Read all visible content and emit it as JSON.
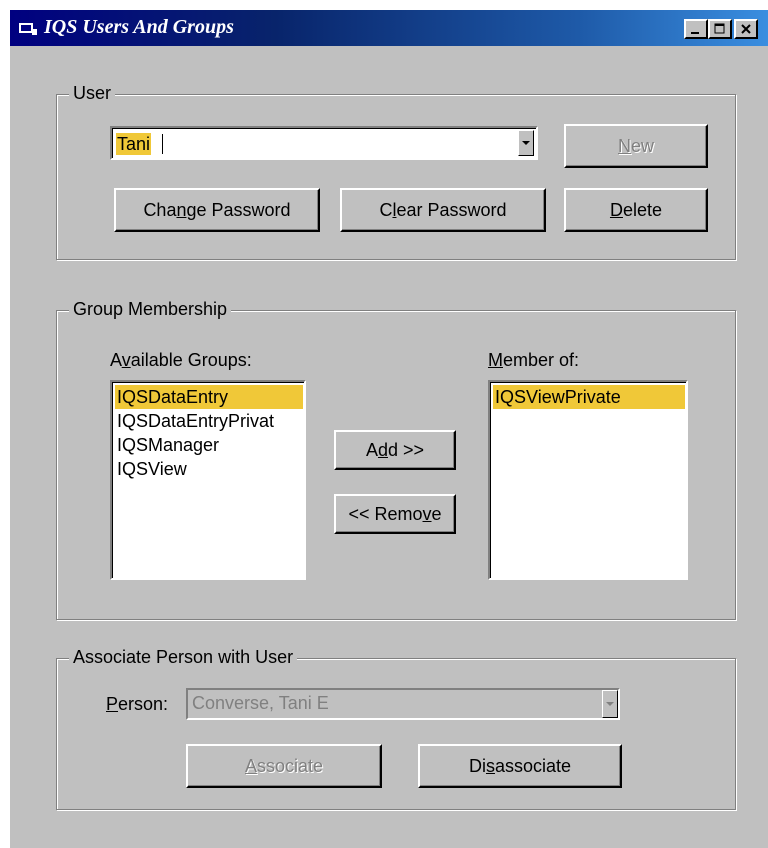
{
  "window": {
    "title": "IQS Users And Groups",
    "controls": {
      "minimize": "_",
      "maximize": "□",
      "close": "×"
    }
  },
  "user_group": {
    "label": "User",
    "user_combo_value": "Tani",
    "new_button": {
      "pre": "",
      "key": "N",
      "post": "ew"
    },
    "change_password_button": {
      "pre": "Cha",
      "key": "n",
      "post": "ge Password"
    },
    "clear_password_button": {
      "pre": "C",
      "key": "l",
      "post": "ear Password"
    },
    "delete_button": {
      "pre": "",
      "key": "D",
      "post": "elete"
    }
  },
  "membership_group": {
    "label": "Group Membership",
    "available_label": {
      "pre": "A",
      "key": "v",
      "post": "ailable Groups:"
    },
    "member_label": {
      "pre": "",
      "key": "M",
      "post": "ember of:"
    },
    "available_groups": [
      "IQSDataEntry",
      "IQSDataEntryPrivat",
      "IQSManager",
      "IQSView"
    ],
    "member_of": [
      "IQSViewPrivate"
    ],
    "add_button": {
      "pre": "A",
      "key": "d",
      "post": "d >>"
    },
    "remove_button": {
      "pre": "<< Remo",
      "key": "v",
      "post": "e"
    }
  },
  "associate_group": {
    "label": "Associate Person with User",
    "person_label": {
      "pre": "",
      "key": "P",
      "post": "erson:"
    },
    "person_value": "Converse, Tani E",
    "associate_button": {
      "pre": "",
      "key": "A",
      "post": "ssociate"
    },
    "disassociate_button": {
      "pre": "Di",
      "key": "s",
      "post": "associate"
    }
  },
  "colors": {
    "selection": "#f0c838",
    "face": "#c0c0c0",
    "title_start": "#000080",
    "title_end": "#3a8ee0"
  }
}
